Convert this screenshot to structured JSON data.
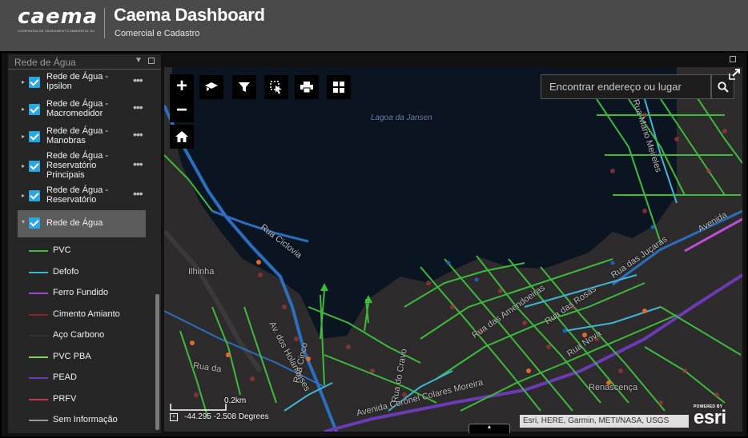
{
  "header": {
    "logo_text": "caema",
    "logo_subtext": "COMPANHIA DE SANEAMENTO AMBIENTAL DO MARANHÃO",
    "title": "Caema Dashboard",
    "subtitle": "Comercial e Cadastro"
  },
  "sidebar": {
    "panel_title": "Rede de Água",
    "layers": [
      {
        "label": "Rede de Água - Ipsilon",
        "checked": true
      },
      {
        "label": "Rede de Água - Macromedidor",
        "checked": true
      },
      {
        "label": "Rede de Água - Manobras",
        "checked": true
      },
      {
        "label": "Rede de Água - Reservatório Principais",
        "checked": true
      },
      {
        "label": "Rede de Água - Reservatório",
        "checked": true
      },
      {
        "label": "Rede de Água",
        "checked": true,
        "selected": true
      }
    ],
    "legend": [
      {
        "label": "PVC",
        "color": "#3dbb3d"
      },
      {
        "label": "Defofo",
        "color": "#3fb6d6"
      },
      {
        "label": "Ferro Fundido",
        "color": "#9a4bd6"
      },
      {
        "label": "Cimento Amianto",
        "color": "#8a2222"
      },
      {
        "label": "Aço Carbono",
        "color": "#333333"
      },
      {
        "label": "PVC PBA",
        "color": "#7fd35b"
      },
      {
        "label": "PEAD",
        "color": "#6a3bb5"
      },
      {
        "label": "PRFV",
        "color": "#c0394b"
      },
      {
        "label": "Sem Informação",
        "color": "#9a9a9a"
      }
    ]
  },
  "map": {
    "search_placeholder": "Encontrar endereço ou lugar",
    "water_label": "Lagoa da Jansen",
    "labels": {
      "rua_cicloviaria": "Rua Ciclovia",
      "rua_mario": "Rua Mario Meireles",
      "rua_jucaras": "Rua das Juçaras",
      "av": "Avenida",
      "ilhinha": "Ilhinha",
      "av_holandeses": "Av. dos Holandeses",
      "rua_cinco": "Rua Cinco",
      "rua_cravo": "Rua do Cravo",
      "rua_da": "Rua da",
      "rua_amendoeiras": "Rua das Amendoeiras",
      "rua_rosas": "Rua das Rosas",
      "av_colares": "Avenida Coronel Colares Moreira",
      "renascenca": "Renascença",
      "rua_nova": "Rua Nova"
    },
    "scale": "0.2km",
    "coordinates": "-44.295 -2.508 Degrees",
    "attribution": "Esri, HERE, Garmin, METI/NASA, USGS",
    "esri_powered": "POWERED BY",
    "esri_logo": "esri"
  },
  "icons": {
    "zoom_in": "+",
    "zoom_out": "−",
    "home": "home-icon",
    "basemap": "basemap-icon",
    "filter": "filter-icon",
    "select": "select-icon",
    "print": "print-icon",
    "grid": "grid-icon",
    "search": "search-icon"
  }
}
